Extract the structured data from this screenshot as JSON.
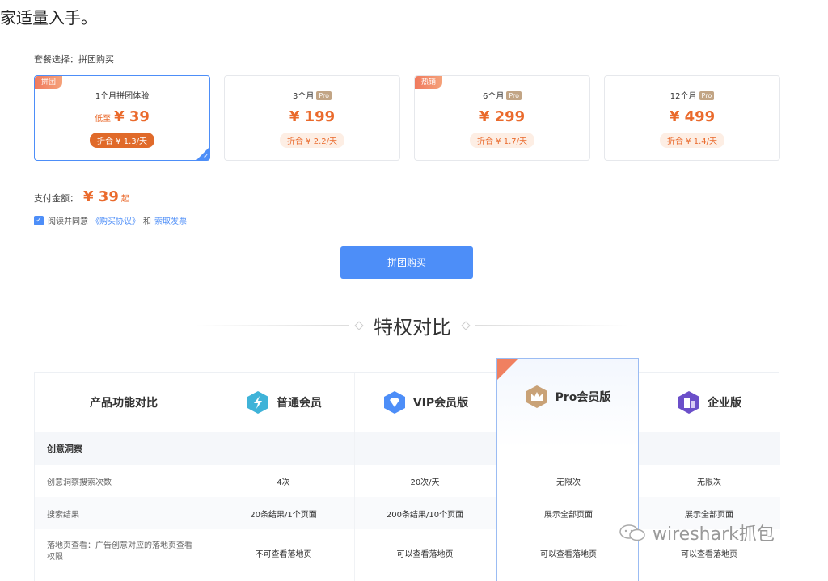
{
  "article": {
    "top_text": "家适量入手。"
  },
  "purchase": {
    "package_label": "套餐选择：拼团购买",
    "plans": [
      {
        "tag": "拼团",
        "name": "1个月拼团体验",
        "pro": "",
        "low_label": "低至",
        "price": "¥ 39",
        "daily": "折合 ¥ 1.3/天",
        "selected": true
      },
      {
        "tag": "",
        "name": "3个月",
        "pro": "Pro",
        "low_label": "",
        "price": "¥ 199",
        "daily": "折合 ¥ 2.2/天",
        "selected": false
      },
      {
        "tag": "热销",
        "name": "6个月",
        "pro": "Pro",
        "low_label": "",
        "price": "¥ 299",
        "daily": "折合 ¥ 1.7/天",
        "selected": false
      },
      {
        "tag": "",
        "name": "12个月",
        "pro": "Pro",
        "low_label": "",
        "price": "¥ 499",
        "daily": "折合 ¥ 1.4/天",
        "selected": false
      }
    ],
    "pay_label": "支付金额：",
    "pay_amount": "¥ 39",
    "pay_suffix": "起",
    "agree_prefix": "阅读并同意",
    "agree_link1": "《购买协议》",
    "agree_and": "和",
    "agree_link2": "索取发票",
    "buy_button": "拼团购买"
  },
  "comparison": {
    "title": "特权对比",
    "header_first": "产品功能对比",
    "tiers": [
      {
        "name": "普通会员",
        "icon": "lightning-icon",
        "color": "#3fb3d8"
      },
      {
        "name": "VIP会员版",
        "icon": "diamond-icon",
        "color": "#4d8ef8"
      },
      {
        "name": "Pro会员版",
        "icon": "crown-icon",
        "color": "#c9a277"
      },
      {
        "name": "企业版",
        "icon": "building-icon",
        "color": "#6b4fc9"
      }
    ],
    "category": "创意洞察",
    "rows": [
      {
        "feature": "创意洞察搜索次数",
        "values": [
          "4次",
          "20次/天",
          "无限次",
          "无限次"
        ]
      },
      {
        "feature": "搜索结果",
        "values": [
          "20条结果/1个页面",
          "200条结果/10个页面",
          "展示全部页面",
          "展示全部页面"
        ]
      },
      {
        "feature_line1": "落地页查看：广告创意对应的落地页查看",
        "feature_line2": "权限",
        "values": [
          "不可查看落地页",
          "可以查看落地页",
          "可以查看落地页",
          "可以查看落地页"
        ]
      }
    ]
  },
  "watermark": {
    "text": "wireshark抓包"
  }
}
